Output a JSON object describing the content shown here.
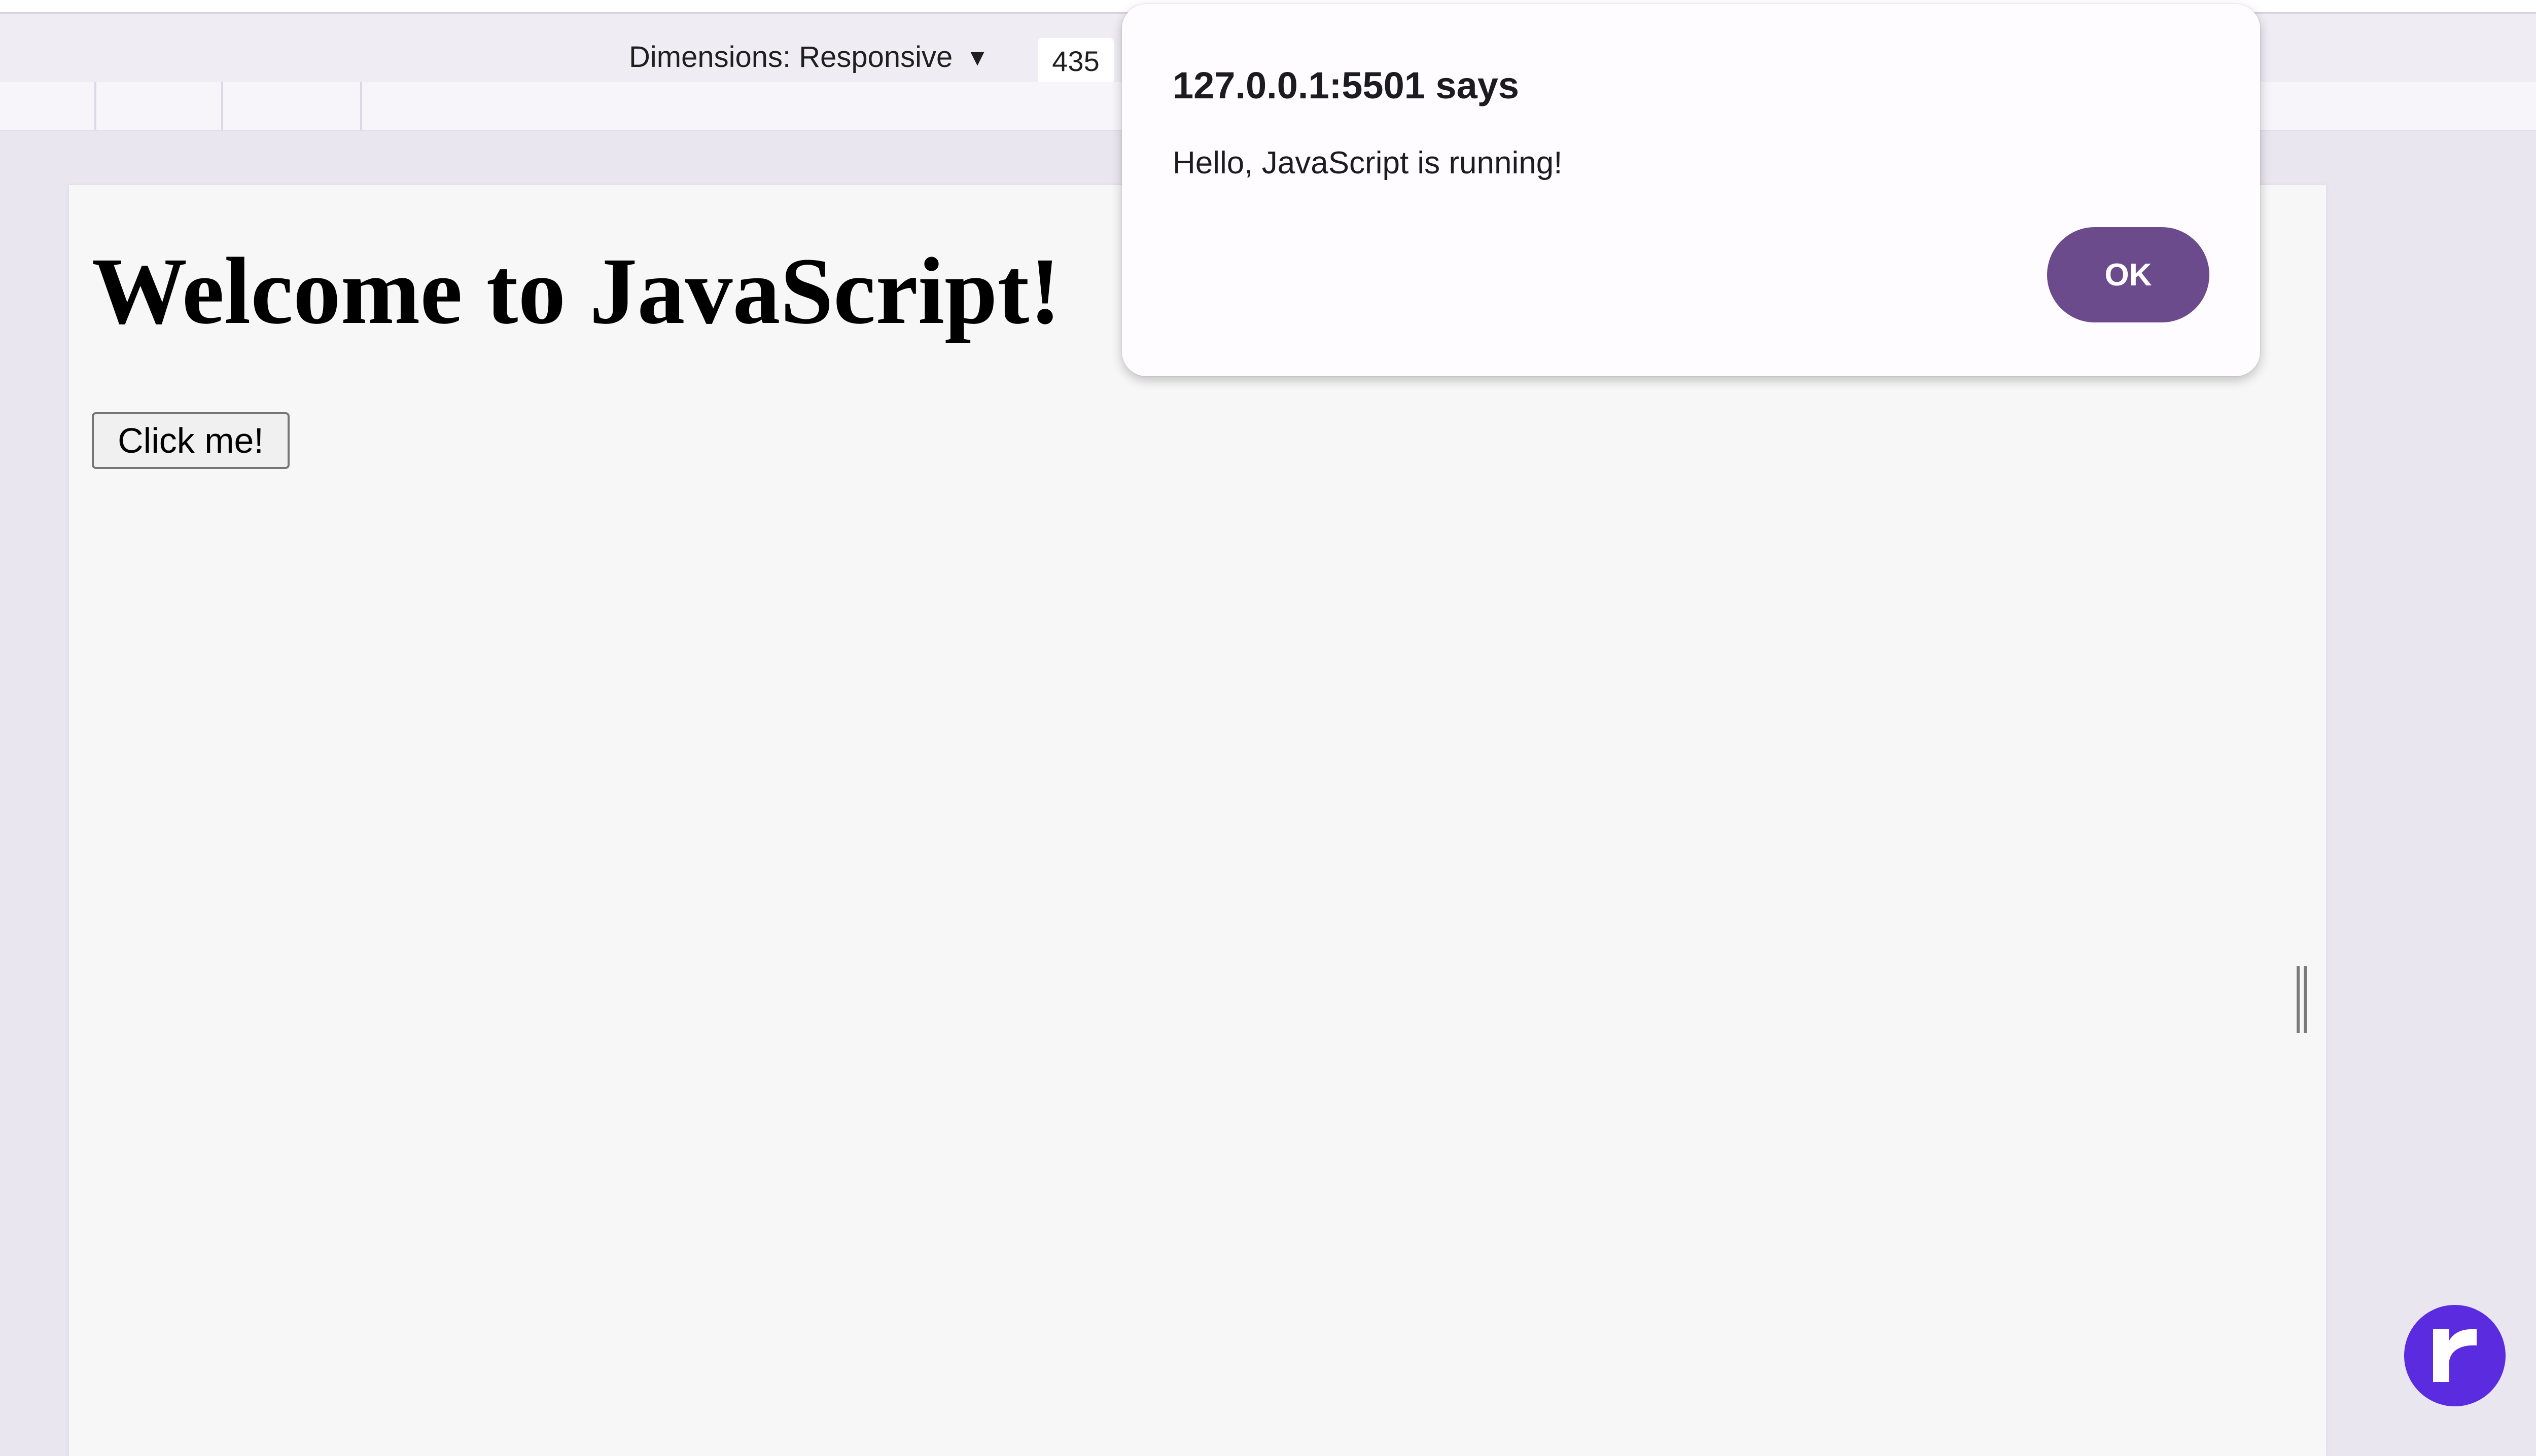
{
  "devtools": {
    "dimensions_label": "Dimensions: Responsive",
    "dimensions_caret": "▼",
    "width_value": "435"
  },
  "page": {
    "heading": "Welcome to JavaScript!",
    "button_label": "Click me!"
  },
  "alert": {
    "title": "127.0.0.1:5501 says",
    "message": "Hello, JavaScript is running!",
    "ok_label": "OK",
    "ok_color": "#6c4b8c"
  },
  "fab": {
    "icon": "r-logo-icon",
    "color": "#5b2be0"
  }
}
